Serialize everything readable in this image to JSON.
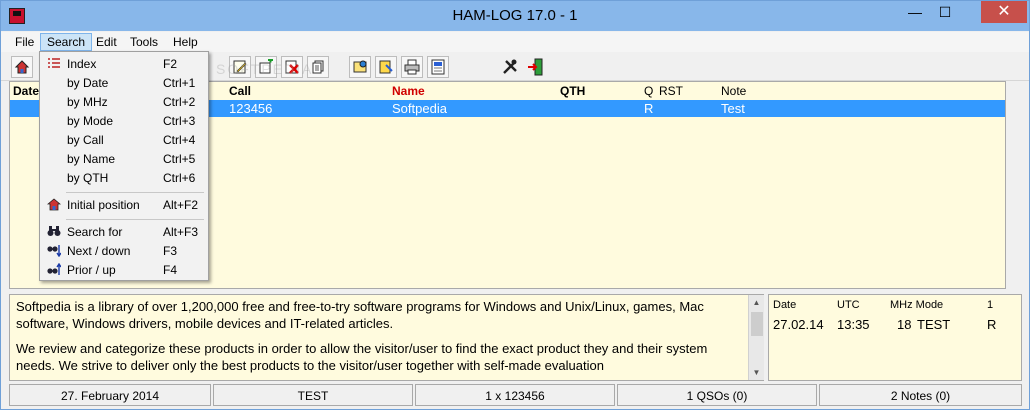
{
  "window": {
    "title": "HAM-LOG  17.0 -  1"
  },
  "title_buttons": {
    "minimize": "—",
    "maximize": "☐",
    "close": "✕"
  },
  "menubar": {
    "items": [
      "File",
      "Search",
      "Edit",
      "Tools",
      "Help"
    ]
  },
  "toolbar": {
    "icons": [
      "home-icon",
      "find-icon",
      "edit-icon",
      "add-icon",
      "delete-icon",
      "copy-icon",
      "properties-icon",
      "label-icon",
      "print-icon",
      "calc-icon",
      "tools-icon",
      "exit-icon"
    ]
  },
  "list": {
    "headers": {
      "date": "Date",
      "call": "Call",
      "name": "Name",
      "qth": "QTH",
      "q": "Q",
      "rst": "RST",
      "note": "Note"
    },
    "rows": [
      {
        "call": "123456",
        "name": "Softpedia",
        "q": "R",
        "note": "Test"
      }
    ]
  },
  "search_menu": {
    "items": [
      {
        "label": "Index",
        "shortcut": "F2",
        "icon": "index-icon"
      },
      {
        "label": "by Date",
        "shortcut": "Ctrl+1"
      },
      {
        "label": "by MHz",
        "shortcut": "Ctrl+2"
      },
      {
        "label": "by Mode",
        "shortcut": "Ctrl+3"
      },
      {
        "label": "by Call",
        "shortcut": "Ctrl+4"
      },
      {
        "label": "by Name",
        "shortcut": "Ctrl+5"
      },
      {
        "label": "by QTH",
        "shortcut": "Ctrl+6"
      },
      {
        "label": "Initial position",
        "shortcut": "Alt+F2",
        "icon": "home-icon"
      },
      {
        "label": "Search for",
        "shortcut": "Alt+F3",
        "icon": "binoculars-icon"
      },
      {
        "label": "Next / down",
        "shortcut": "F3",
        "icon": "binoculars-down-icon"
      },
      {
        "label": "Prior / up",
        "shortcut": "F4",
        "icon": "binoculars-up-icon"
      }
    ]
  },
  "notes": {
    "paragraph1": "Softpedia is a library of over 1,200,000 free and free-to-try software programs for Windows and Unix/Linux, games, Mac software, Windows drivers, mobile devices and IT-related articles.",
    "paragraph2": "We review and categorize these products in order to allow the visitor/user to find the exact product they and their system needs. We strive to deliver only the best products to the visitor/user together with self-made evaluation"
  },
  "qso_panel": {
    "headers": {
      "date": "Date",
      "utc": "UTC",
      "mhz_mode": "MHz Mode",
      "count": "1"
    },
    "row": {
      "date": "27.02.14",
      "utc": "13:35",
      "mhz": "18",
      "mode": "TEST",
      "flag": "R"
    }
  },
  "statusbar": {
    "date": "27. February 2014",
    "mode": "TEST",
    "call_count": "1 x 123456",
    "qsos": "1 QSOs (0)",
    "notes": "2 Notes (0)"
  },
  "watermark": "SOFTPEDIA"
}
